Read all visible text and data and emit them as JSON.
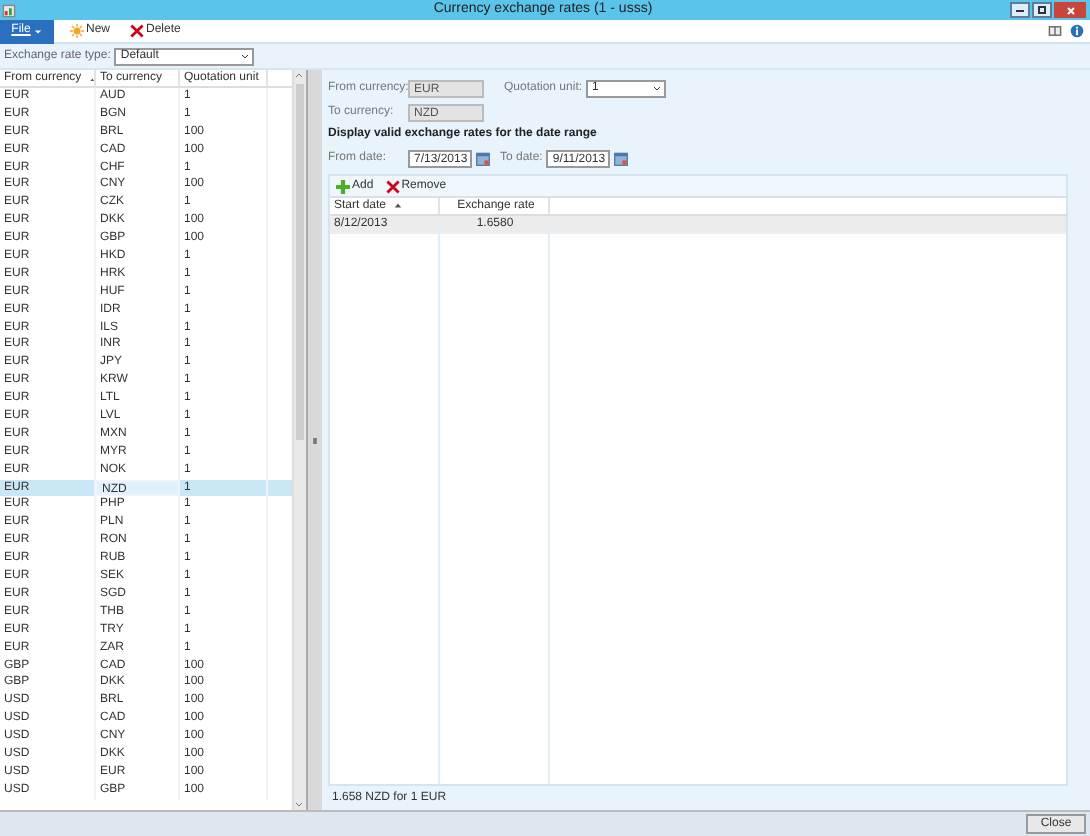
{
  "window": {
    "title": "Currency exchange rates (1 - usss)"
  },
  "ribbon": {
    "file_tab": "File",
    "buttons": [
      {
        "kind": "new",
        "label": "New"
      },
      {
        "kind": "delete",
        "label": "Delete"
      }
    ]
  },
  "filter": {
    "label": "Exchange rate type:",
    "value": "Default"
  },
  "grid": {
    "columns": [
      "From currency",
      "To currency",
      "Quotation unit"
    ],
    "rows": [
      {
        "from": "EUR",
        "to": "AUD",
        "unit": "1",
        "selected": false
      },
      {
        "from": "EUR",
        "to": "BGN",
        "unit": "1",
        "selected": false
      },
      {
        "from": "EUR",
        "to": "BRL",
        "unit": "100",
        "selected": false
      },
      {
        "from": "EUR",
        "to": "CAD",
        "unit": "100",
        "selected": false
      },
      {
        "from": "EUR",
        "to": "CHF",
        "unit": "1",
        "selected": false
      },
      {
        "from": "EUR",
        "to": "CNY",
        "unit": "100",
        "selected": false
      },
      {
        "from": "EUR",
        "to": "CZK",
        "unit": "1",
        "selected": false
      },
      {
        "from": "EUR",
        "to": "DKK",
        "unit": "100",
        "selected": false
      },
      {
        "from": "EUR",
        "to": "GBP",
        "unit": "100",
        "selected": false
      },
      {
        "from": "EUR",
        "to": "HKD",
        "unit": "1",
        "selected": false
      },
      {
        "from": "EUR",
        "to": "HRK",
        "unit": "1",
        "selected": false
      },
      {
        "from": "EUR",
        "to": "HUF",
        "unit": "1",
        "selected": false
      },
      {
        "from": "EUR",
        "to": "IDR",
        "unit": "1",
        "selected": false
      },
      {
        "from": "EUR",
        "to": "ILS",
        "unit": "1",
        "selected": false
      },
      {
        "from": "EUR",
        "to": "INR",
        "unit": "1",
        "selected": false
      },
      {
        "from": "EUR",
        "to": "JPY",
        "unit": "1",
        "selected": false
      },
      {
        "from": "EUR",
        "to": "KRW",
        "unit": "1",
        "selected": false
      },
      {
        "from": "EUR",
        "to": "LTL",
        "unit": "1",
        "selected": false
      },
      {
        "from": "EUR",
        "to": "LVL",
        "unit": "1",
        "selected": false
      },
      {
        "from": "EUR",
        "to": "MXN",
        "unit": "1",
        "selected": false
      },
      {
        "from": "EUR",
        "to": "MYR",
        "unit": "1",
        "selected": false
      },
      {
        "from": "EUR",
        "to": "NOK",
        "unit": "1",
        "selected": false
      },
      {
        "from": "EUR",
        "to": "NZD",
        "unit": "1",
        "selected": true
      },
      {
        "from": "EUR",
        "to": "PHP",
        "unit": "1",
        "selected": false
      },
      {
        "from": "EUR",
        "to": "PLN",
        "unit": "1",
        "selected": false
      },
      {
        "from": "EUR",
        "to": "RON",
        "unit": "1",
        "selected": false
      },
      {
        "from": "EUR",
        "to": "RUB",
        "unit": "1",
        "selected": false
      },
      {
        "from": "EUR",
        "to": "SEK",
        "unit": "1",
        "selected": false
      },
      {
        "from": "EUR",
        "to": "SGD",
        "unit": "1",
        "selected": false
      },
      {
        "from": "EUR",
        "to": "THB",
        "unit": "1",
        "selected": false
      },
      {
        "from": "EUR",
        "to": "TRY",
        "unit": "1",
        "selected": false
      },
      {
        "from": "EUR",
        "to": "ZAR",
        "unit": "1",
        "selected": false
      },
      {
        "from": "GBP",
        "to": "CAD",
        "unit": "100",
        "selected": false
      },
      {
        "from": "GBP",
        "to": "DKK",
        "unit": "100",
        "selected": false
      },
      {
        "from": "USD",
        "to": "BRL",
        "unit": "100",
        "selected": false
      },
      {
        "from": "USD",
        "to": "CAD",
        "unit": "100",
        "selected": false
      },
      {
        "from": "USD",
        "to": "CNY",
        "unit": "100",
        "selected": false
      },
      {
        "from": "USD",
        "to": "DKK",
        "unit": "100",
        "selected": false
      },
      {
        "from": "USD",
        "to": "EUR",
        "unit": "100",
        "selected": false
      },
      {
        "from": "USD",
        "to": "GBP",
        "unit": "100",
        "selected": false
      }
    ]
  },
  "detail": {
    "from_label": "From currency:",
    "from_value": "EUR",
    "unit_label": "Quotation unit:",
    "unit_value": "1",
    "to_label": "To currency:",
    "to_value": "NZD",
    "range_heading": "Display valid exchange rates for the date range",
    "from_date_label": "From date:",
    "from_date": "7/13/2013",
    "to_date_label": "To date:",
    "to_date": "9/11/2013",
    "toolbar": [
      {
        "kind": "add",
        "label": "Add"
      },
      {
        "kind": "remove",
        "label": "Remove"
      }
    ],
    "rates": {
      "columns": [
        "Start date",
        "Exchange rate"
      ],
      "rows": [
        {
          "start": "8/12/2013",
          "rate": "1.6580",
          "selected": true
        }
      ]
    },
    "summary": "1.658 NZD for 1 EUR"
  },
  "buttons": [
    "Close"
  ]
}
